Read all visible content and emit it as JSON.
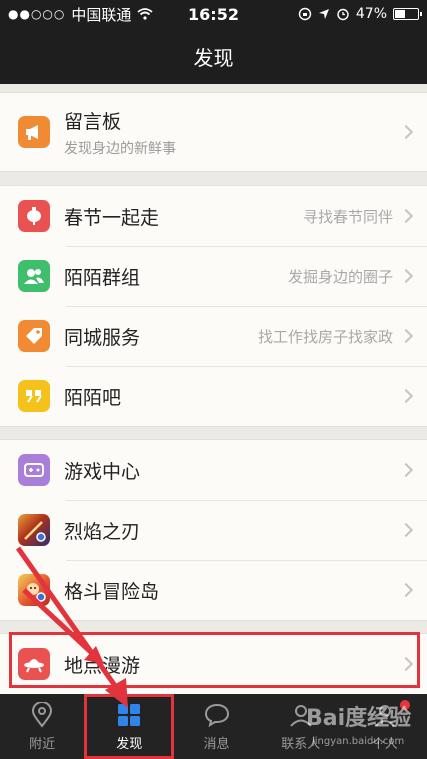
{
  "status_bar": {
    "carrier_dots": "●●○○○",
    "carrier": "中国联通",
    "time": "16:52",
    "battery": "47%"
  },
  "nav": {
    "title": "发现"
  },
  "groups": [
    [
      {
        "title": "留言板",
        "subtitle": "发现身边的新鲜事",
        "icon": "megaphone-icon",
        "color": "#f08a33"
      }
    ],
    [
      {
        "title": "春节一起走",
        "hint": "寻找春节同伴",
        "icon": "lantern-icon",
        "color": "#ea5151"
      },
      {
        "title": "陌陌群组",
        "hint": "发掘身边的圈子",
        "icon": "group-icon",
        "color": "#3fbe6c"
      },
      {
        "title": "同城服务",
        "hint": "找工作找房子找家政",
        "icon": "tag-icon",
        "color": "#f08a33"
      },
      {
        "title": "陌陌吧",
        "icon": "quote-icon",
        "color": "#f5c21b"
      }
    ],
    [
      {
        "title": "游戏中心",
        "icon": "gamepad-icon",
        "color": "#a97fd9"
      },
      {
        "title": "烈焰之刃",
        "icon": "game-thumbnail-icon",
        "color": "#7a3a20"
      },
      {
        "title": "格斗冒险岛",
        "icon": "game-thumbnail-icon",
        "color": "#d8452d"
      }
    ],
    [
      {
        "title": "地点漫游",
        "icon": "ufo-icon",
        "color": "#ea5151"
      }
    ]
  ],
  "tabs": [
    {
      "label": "附近",
      "icon": "location-pin-icon"
    },
    {
      "label": "发现",
      "icon": "grid-icon",
      "active": true
    },
    {
      "label": "消息",
      "icon": "chat-bubble-icon"
    },
    {
      "label": "联系人",
      "icon": "person-icon"
    },
    {
      "label": "个人",
      "icon": "profile-icon"
    }
  ],
  "watermark": {
    "logo": "Bai度经验",
    "url": "jingyan.baidu.com"
  }
}
